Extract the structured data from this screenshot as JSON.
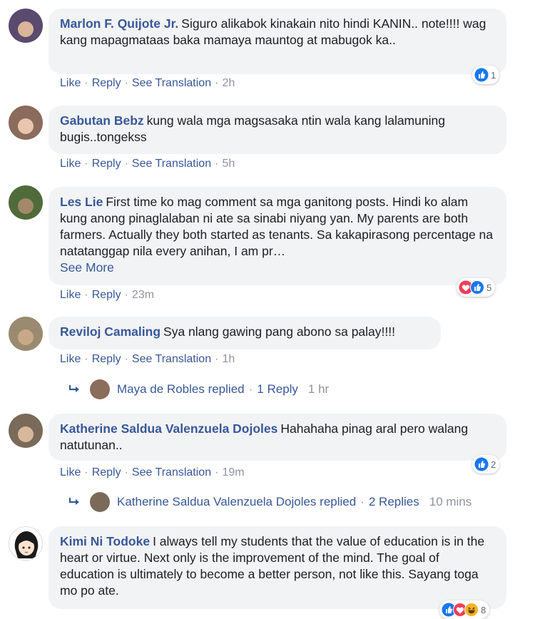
{
  "comments": [
    {
      "author": "Marlon F. Quijote Jr.",
      "text": "Siguro alikabok kinakain nito hindi KANIN.. note!!!! wag kang mapagmataas baka mamaya mauntog at mabugok ka..",
      "actions": {
        "like": "Like",
        "reply": "Reply",
        "translate": "See Translation",
        "time": "2h"
      },
      "reactions": {
        "count": "1"
      },
      "avatar_color": "#5a4a6e"
    },
    {
      "author": "Gabutan Bebz",
      "text": "kung wala mga magsasaka ntin wala kang lalamuning bugis..tongekss",
      "actions": {
        "like": "Like",
        "reply": "Reply",
        "translate": "See Translation",
        "time": "5h"
      },
      "avatar_color": "#8a6b5c"
    },
    {
      "author": "Les Lie",
      "text": "First time ko mag comment sa mga ganitong posts. Hindi ko alam kung anong pinaglalaban ni ate sa sinabi niyang yan. My parents are both farmers. Actually they both started as tenants. Sa kakapirasong percentage na natatanggap nila every anihan, I am pr…",
      "see_more": "See More",
      "actions": {
        "like": "Like",
        "reply": "Reply",
        "time": "23m"
      },
      "reactions": {
        "count": "5"
      },
      "avatar_color": "#4f6b3a"
    },
    {
      "author": "Reviloj Camaling",
      "text": "Sya nlang gawing pang abono sa palay!!!!",
      "actions": {
        "like": "Like",
        "reply": "Reply",
        "translate": "See Translation",
        "time": "1h"
      },
      "replies": {
        "name": "Maya de Robles replied",
        "count": "1 Reply",
        "time": "1 hr"
      },
      "avatar_color": "#9a8a70"
    },
    {
      "author": "Katherine Saldua Valenzuela Dojoles",
      "text": "Hahahaha pinag aral pero walang natutunan..",
      "actions": {
        "like": "Like",
        "reply": "Reply",
        "translate": "See Translation",
        "time": "19m"
      },
      "reactions": {
        "count": "2"
      },
      "replies": {
        "name": "Katherine Saldua Valenzuela Dojoles replied",
        "count": "2 Replies",
        "time": "10 mins"
      },
      "avatar_color": "#7a6a5a"
    },
    {
      "author": "Kimi Ni Todoke",
      "text": "I always tell my students that the value of education is in the heart or virtue. Next only is the improvement of the mind. The goal of education is ultimately to become a better person, not like this. Sayang toga mo po ate.",
      "reactions": {
        "count": "8"
      },
      "avatar_color": "#1a1a1a"
    }
  ],
  "colors": {
    "link": "#385898",
    "bubble": "#f2f3f5",
    "like_blue": "#1877f2",
    "love_red": "#f33e58",
    "haha_yellow": "#f7b125"
  }
}
